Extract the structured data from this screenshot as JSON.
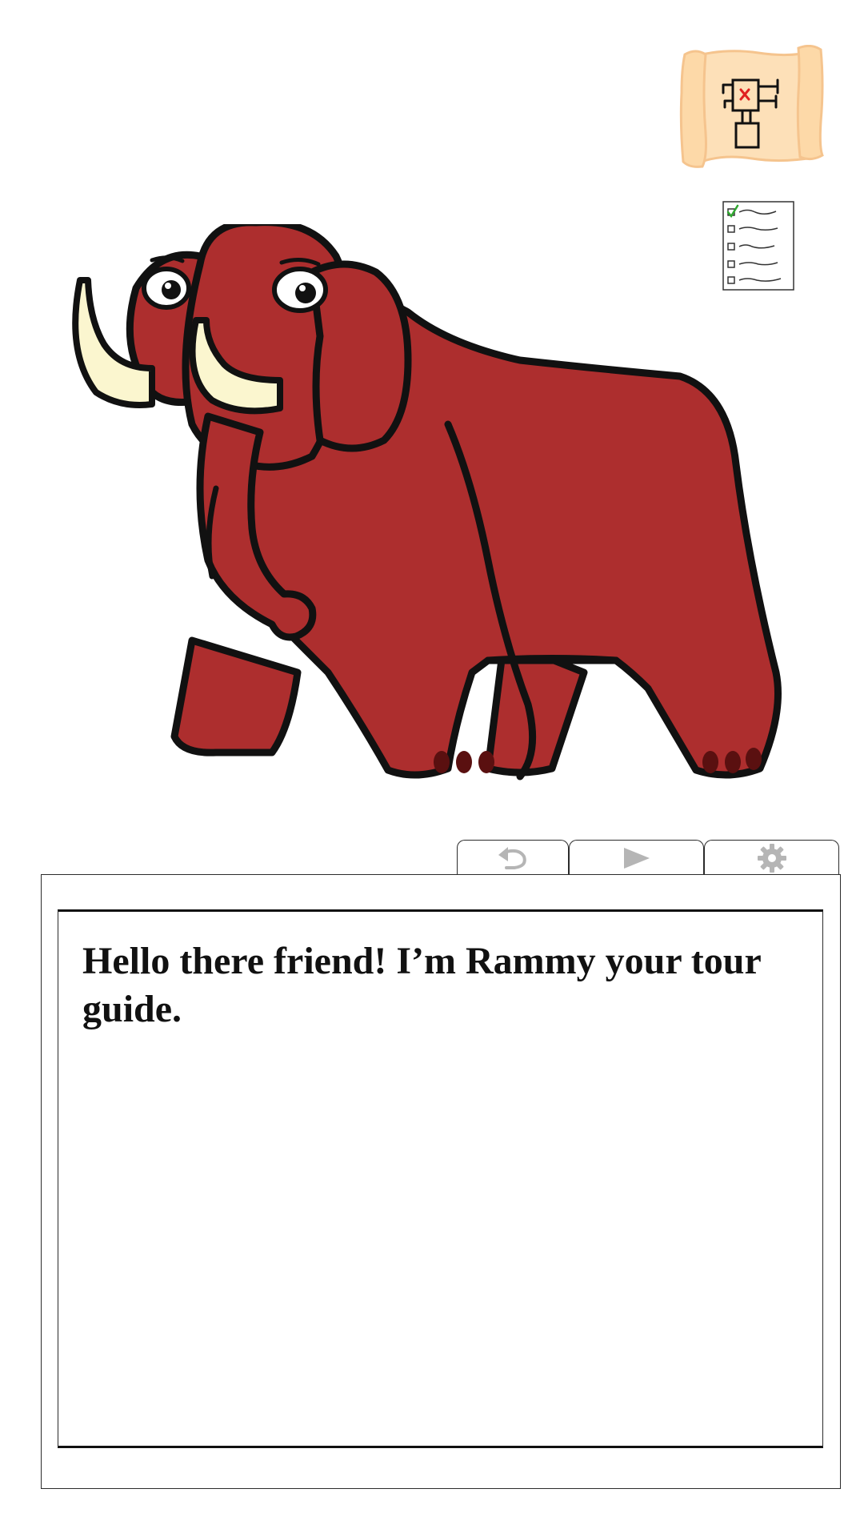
{
  "colors": {
    "mammoth_body": "#ad2e2e",
    "tusk": "#fbf6cf",
    "map_parchment": "#fde0b8",
    "map_marker": "#e02020",
    "checklist_check": "#2fa82f",
    "toolbar_icon": "#b5b5b5",
    "outline": "#111111"
  },
  "icons": {
    "map": "treasure-map-icon",
    "checklist": "checklist-icon",
    "undo": "undo-icon",
    "play": "play-icon",
    "settings": "gear-icon"
  },
  "dialog": {
    "text": "Hello there friend! I’m Rammy your tour guide."
  }
}
